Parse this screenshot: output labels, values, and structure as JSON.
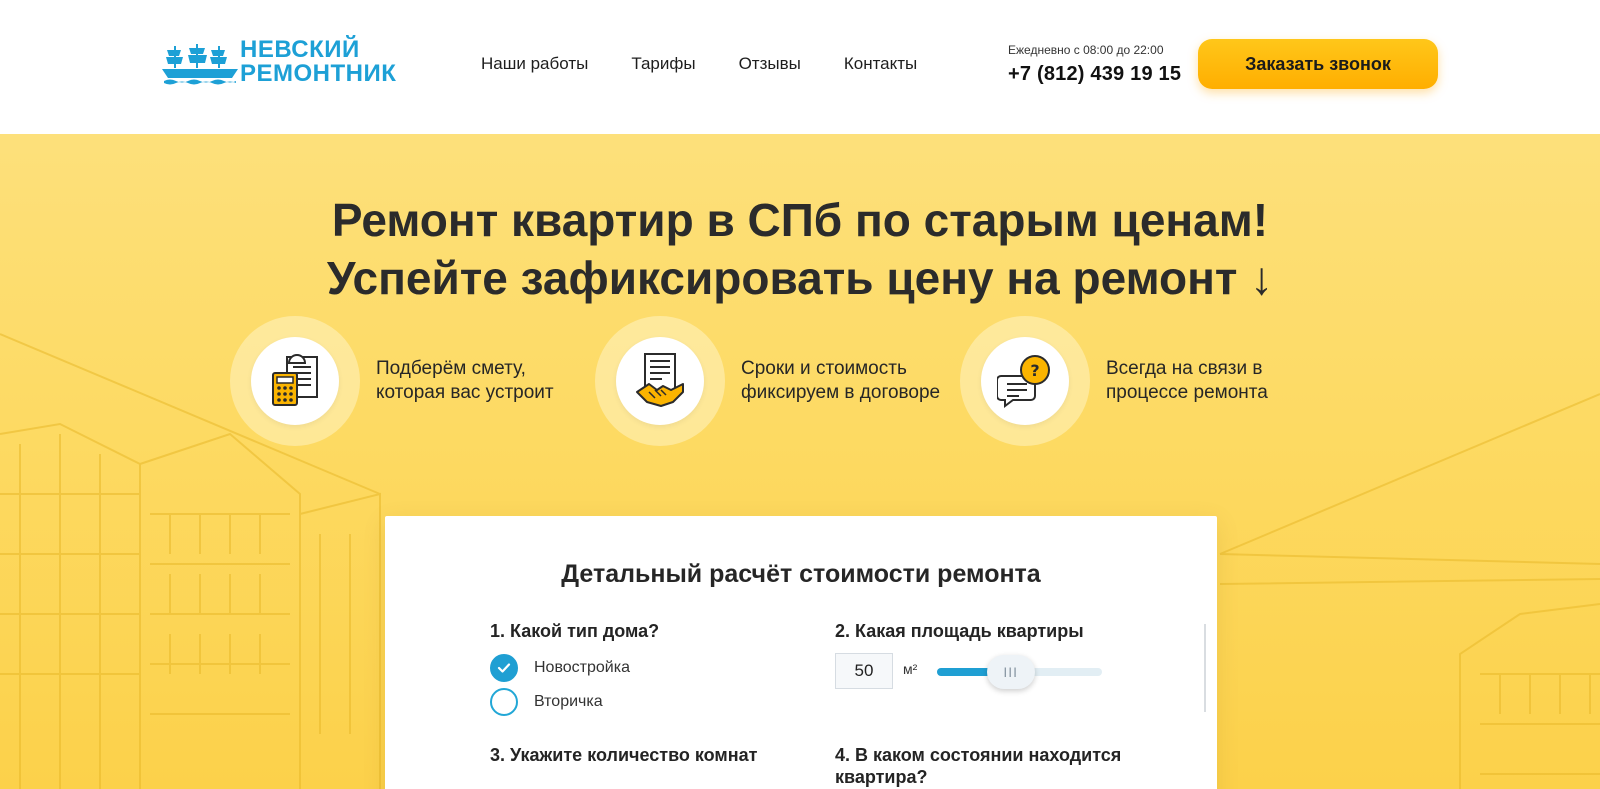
{
  "header": {
    "logo": {
      "line1": "НЕВСКИЙ",
      "line2": "РЕМОНТНИК"
    },
    "nav": [
      "Наши работы",
      "Тарифы",
      "Отзывы",
      "Контакты"
    ],
    "hours": "Ежедневно с 08:00 до 22:00",
    "phone": "+7 (812) 439 19 15",
    "callback_label": "Заказать звонок",
    "colors": {
      "brand": "#1da0d6",
      "button": "#ffb800"
    }
  },
  "hero": {
    "title_line1": "Ремонт квартир в СПб по старым ценам!",
    "title_line2": "Успейте зафиксировать цену на ремонт ↓",
    "features": [
      {
        "icon": "calculator-estimate-icon",
        "line1": "Подберём смету,",
        "line2": "которая вас устроит"
      },
      {
        "icon": "handshake-contract-icon",
        "line1": "Сроки и стоимость",
        "line2": "фиксируем в договоре"
      },
      {
        "icon": "chat-question-icon",
        "line1": "Всегда на связи в",
        "line2": "процессе ремонта"
      }
    ],
    "background_color": "#fdda63"
  },
  "calculator": {
    "title": "Детальный расчёт стоимости ремонта",
    "q1": {
      "label": "1. Какой тип дома?",
      "options": [
        {
          "label": "Новостройка",
          "checked": true
        },
        {
          "label": "Вторичка",
          "checked": false
        }
      ]
    },
    "q2": {
      "label": "2. Какая площадь квартиры",
      "value": "50",
      "unit": "м²",
      "slider_fraction": 0.35
    },
    "q3": {
      "label": "3. Укажите количество комнат"
    },
    "q4": {
      "label": "4. В каком состоянии находится квартира?"
    }
  }
}
